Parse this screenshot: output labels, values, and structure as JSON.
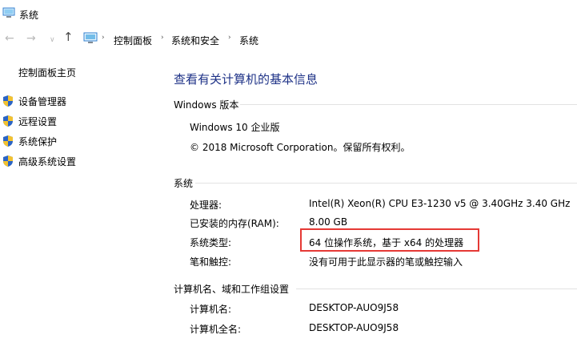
{
  "window": {
    "title": "系统"
  },
  "navigation": {
    "back_glyph": "←",
    "forward_glyph": "→",
    "recent_glyph": "∨",
    "up_glyph": "↑",
    "breadcrumbs": [
      "控制面板",
      "系统和安全",
      "系统"
    ],
    "separator": "›"
  },
  "sidebar": {
    "home": "控制面板主页",
    "items": [
      {
        "label": "设备管理器",
        "icon": "shield-icon"
      },
      {
        "label": "远程设置",
        "icon": "shield-icon"
      },
      {
        "label": "系统保护",
        "icon": "shield-icon"
      },
      {
        "label": "高级系统设置",
        "icon": "shield-icon"
      }
    ]
  },
  "main": {
    "title": "查看有关计算机的基本信息",
    "windows_edition": {
      "heading": "Windows 版本",
      "edition": "Windows 10 企业版",
      "copyright": "© 2018 Microsoft Corporation。保留所有权利。"
    },
    "system": {
      "heading": "系统",
      "rows": [
        {
          "label": "处理器:",
          "value": "Intel(R) Xeon(R) CPU E3-1230 v5 @ 3.40GHz   3.40 GHz"
        },
        {
          "label": "已安装的内存(RAM):",
          "value": "8.00 GB"
        },
        {
          "label": "系统类型:",
          "value": "64 位操作系统，基于 x64 的处理器"
        },
        {
          "label": "笔和触控:",
          "value": "没有可用于此显示器的笔或触控输入"
        }
      ]
    },
    "computer": {
      "heading": "计算机名、域和工作组设置",
      "rows": [
        {
          "label": "计算机名:",
          "value": "DESKTOP-AUO9J58"
        },
        {
          "label": "计算机全名:",
          "value": "DESKTOP-AUO9J58"
        }
      ]
    }
  },
  "colors": {
    "title_blue": "#1e3287",
    "highlight_red": "#e53935",
    "shield_blue": "#2a64c5",
    "shield_yellow": "#f2c231"
  }
}
